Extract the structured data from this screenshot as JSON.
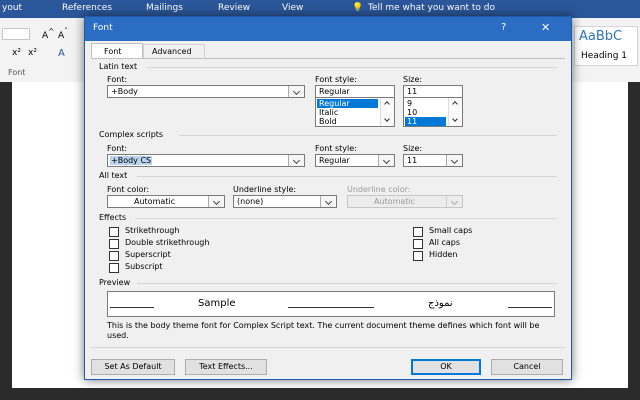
{
  "ribbon": {
    "tabs": [
      "yout",
      "References",
      "Mailings",
      "Review",
      "View"
    ],
    "tell_me": "Tell me what you want to do",
    "font_group_label": "Font",
    "style_preview": "AaBbC",
    "style_name": "Heading 1"
  },
  "dialog": {
    "title": "Font",
    "help_label": "?",
    "close_label": "✕",
    "tabs": [
      "Font",
      "Advanced"
    ],
    "latin": {
      "heading": "Latin text",
      "font_label": "Font:",
      "font_value": "+Body",
      "style_label": "Font style:",
      "style_value": "Regular",
      "style_options": [
        "Regular",
        "Italic",
        "Bold"
      ],
      "size_label": "Size:",
      "size_value": "11",
      "size_options": [
        "9",
        "10",
        "11"
      ]
    },
    "complex": {
      "heading": "Complex scripts",
      "font_label": "Font:",
      "font_value": "+Body CS",
      "style_label": "Font style:",
      "style_value": "Regular",
      "size_label": "Size:",
      "size_value": "11"
    },
    "all_text": {
      "heading": "All text",
      "color_label": "Font color:",
      "color_value": "Automatic",
      "underline_label": "Underline style:",
      "underline_value": "(none)",
      "underline_color_label": "Underline color:",
      "underline_color_value": "Automatic"
    },
    "effects": {
      "heading": "Effects",
      "left": [
        "Strikethrough",
        "Double strikethrough",
        "Superscript",
        "Subscript"
      ],
      "right": [
        "Small caps",
        "All caps",
        "Hidden"
      ]
    },
    "preview": {
      "heading": "Preview",
      "latin_sample": "Sample",
      "complex_sample": "نموذج",
      "note": "This is the body theme font for Complex Script text. The current document theme defines which font will be used."
    },
    "buttons": {
      "set_default": "Set As Default",
      "text_effects": "Text Effects...",
      "ok": "OK",
      "cancel": "Cancel"
    }
  },
  "colors": {
    "title_bar": "#2b6dc2",
    "ribbon_tabs": "#2b579a",
    "selection": "#0078d7"
  }
}
